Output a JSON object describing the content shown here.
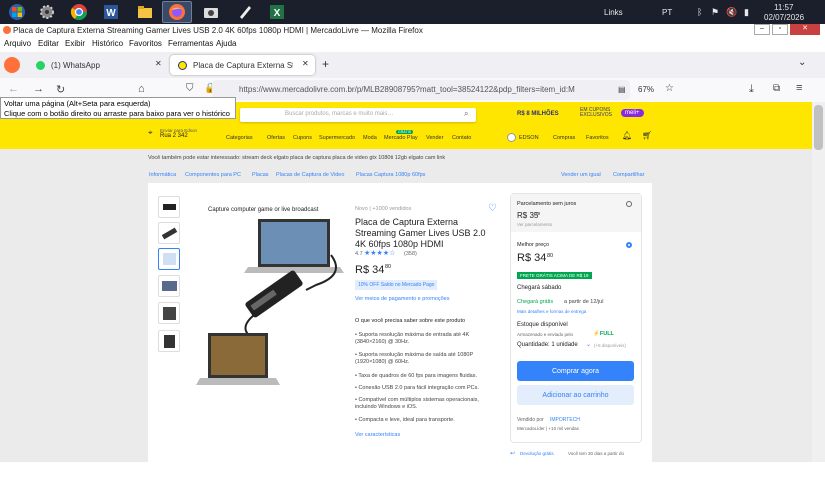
{
  "taskbar": {
    "links_label": "Links",
    "lang": "PT",
    "time": "11:57",
    "date": "02/07/2026"
  },
  "window": {
    "title": "Placa de Captura Externa Streaming Gamer Lives USB 2.0 4K 60fps 1080p HDMI | MercadoLivre — Mozilla Firefox"
  },
  "menu": [
    "Arquivo",
    "Editar",
    "Exibir",
    "Histórico",
    "Favoritos",
    "Ferramentas",
    "Ajuda"
  ],
  "tabs": [
    {
      "label": "(1) WhatsApp"
    },
    {
      "label": "Placa de Captura Externa Strea"
    }
  ],
  "nav": {
    "url": "https://www.mercadolivre.com.br/p/MLB28908795?matt_tool=38524122&pdp_filters=item_id:M",
    "zoom": "67%"
  },
  "tooltip": {
    "line1": "Voltar uma página (Alt+Seta para esquerda)",
    "line2": "Clique com o botão direito ou arraste para baixo para ver o histórico"
  },
  "ml": {
    "search_placeholder": "Buscar produtos, marcas e muito mais…",
    "promo": "R$ 8 MILHÕES",
    "promo2": "EM CUPONS EXCLUSIVOS",
    "meli": "meli+",
    "location_line1": "Enviar para Edson",
    "location_line2": "Rua 2 342",
    "nav_items": [
      "Categorias",
      "Ofertas",
      "Cupons",
      "Supermercado",
      "Moda",
      "Mercado Play",
      "Vender",
      "Contato"
    ],
    "new_badge": "GRÁTIS",
    "user": "EDSON",
    "purchases": "Compras",
    "favorites": "Favoritos"
  },
  "related": "Você também pode estar interessado: stream deck elgato   placa de captura   placa de video gtx 1080ti 12gb   elgato cam link",
  "breadcrumb": [
    "Informática",
    "Componentes para PC",
    "Placas",
    "Placas de Captura de Video",
    "Placas Captura 1080p 60fps"
  ],
  "breadcrumb_right": [
    "Vender um igual",
    "Compartilhar"
  ],
  "product": {
    "image_caption": "Capture computer game or live broadcast",
    "condition": "Novo  |  +1000 vendidos",
    "title": "Placa de Captura Externa Streaming Gamer Lives USB 2.0 4K 60fps 1080p HDMI",
    "rating": "4.7",
    "stars": "★★★★☆",
    "reviews": "(358)",
    "price": "R$ 34",
    "price_cents": "80",
    "discount_badge": "10% OFF Saldo no Mercado Pago",
    "payment_link": "Ver meios de pagamento e promoções",
    "features_title": "O que você precisa saber sobre este produto",
    "features": [
      "Suporta resolução máxima de entrada até 4K (3840×2160) @ 30Hz.",
      "Suporta resolução máxima de saída até 1080P (1920×1080) @ 60Hz.",
      "Taxa de quadros de 60 fps para imagens fluidas.",
      "Conexão USB 2.0 para fácil integração com PCs.",
      "Compatível com múltiplos sistemas operacionais, incluindo Windows e iOS.",
      "Compacta e leve, ideal para transporte."
    ],
    "features_link": "Ver características"
  },
  "buybox": {
    "installment_title": "Parcelamento sem juros",
    "installment_price": "R$ 35",
    "installment_cents": "38",
    "installment_note": "Ver parcelamento",
    "best_price_label": "Melhor preço",
    "best_price": "R$ 34",
    "best_price_cents": "80",
    "free_shipping": "FRETE GRÁTIS ACIMA DE R$ 19",
    "arrival": "Chegará sábado",
    "free_ship_text": "Chegará grátis",
    "free_ship_suffix": "a partir de 12/jul",
    "ship_details": "Mais detalhes e formas de entrega",
    "stock": "Estoque disponível",
    "stock_note": "Armazenado e enviado pelo",
    "full": "FULL",
    "quantity": "Quantidade: 1 unidade",
    "quantity_note": "(+5 disponíveis)",
    "buy_now": "Comprar agora",
    "add_cart": "Adicionar ao carrinho",
    "seller_prefix": "Vendido por",
    "seller": "IMPORTECH",
    "seller_note": "MercadoLíder | +10 mil vendas",
    "return": "Devolução grátis.",
    "return_note": "Você tem 30 dias a partir do"
  }
}
